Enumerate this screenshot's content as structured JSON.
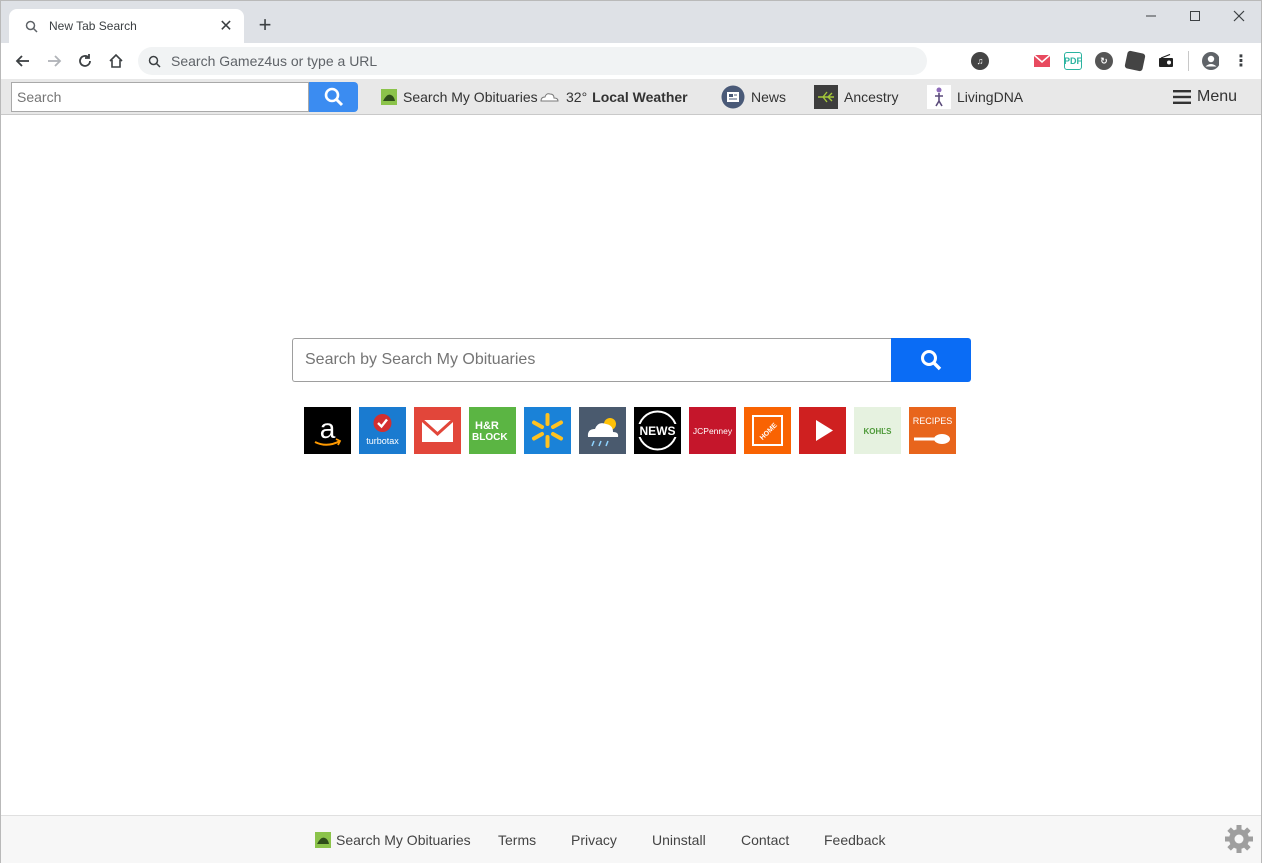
{
  "tab": {
    "title": "New Tab Search",
    "close": "✕",
    "new": "+"
  },
  "omnibox": {
    "text": "Search Gamez4us or type a URL"
  },
  "extbar": {
    "search_placeholder": "Search",
    "obituaries": "Search My Obituaries",
    "weather_temp": "32°",
    "weather_label": "Local Weather",
    "news": "News",
    "ancestry": "Ancestry",
    "livingdna": "LivingDNA",
    "menu": "Menu"
  },
  "main": {
    "search_placeholder": "Search by Search My Obituaries",
    "tiles": [
      {
        "name": "amazon-tile",
        "text": "a",
        "bg": "#000000"
      },
      {
        "name": "turbotax-tile",
        "text": "turbotax",
        "bg": "#1a7bd0"
      },
      {
        "name": "gmail-tile",
        "text": "",
        "bg": "#e2463a"
      },
      {
        "name": "hrblock-tile",
        "text": "H&R BLOCK",
        "bg": "#5bb543"
      },
      {
        "name": "walmart-tile",
        "text": "",
        "bg": "#1a82d8"
      },
      {
        "name": "weather-tile",
        "text": "",
        "bg": "#4a5a6e"
      },
      {
        "name": "news-tile",
        "text": "NEWS",
        "bg": "#000000"
      },
      {
        "name": "jcpenney-tile",
        "text": "JCPenney",
        "bg": "#c5162b"
      },
      {
        "name": "homedepot-tile",
        "text": "THE HOME DEPOT",
        "bg": "#f96302"
      },
      {
        "name": "youtube-tile",
        "text": "",
        "bg": "#cf2020"
      },
      {
        "name": "kohls-tile",
        "text": "KOHĽS",
        "bg": "#e6f2e0"
      },
      {
        "name": "recipes-tile",
        "text": "RECIPES",
        "bg": "#e8651c"
      }
    ]
  },
  "footer": {
    "obituaries": "Search My Obituaries",
    "terms": "Terms",
    "privacy": "Privacy",
    "uninstall": "Uninstall",
    "contact": "Contact",
    "feedback": "Feedback"
  }
}
